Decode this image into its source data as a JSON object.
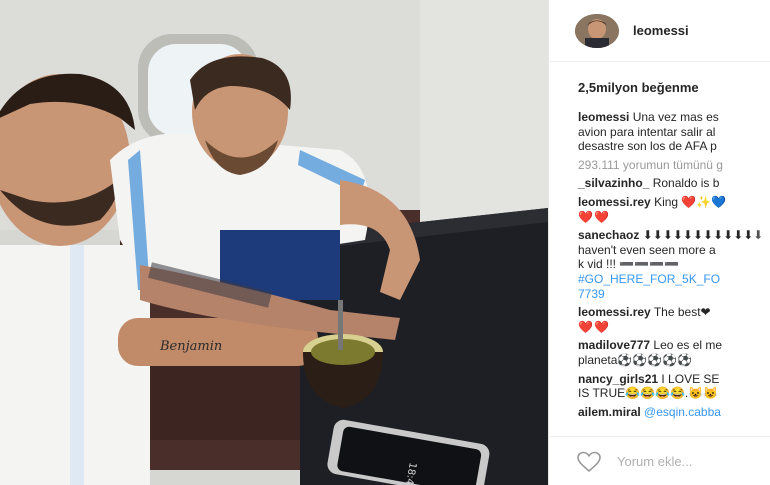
{
  "post": {
    "username": "leomessi",
    "likes": "2,5milyon beğenme",
    "caption": {
      "user": "leomessi",
      "lines": [
        "Una vez mas es",
        "avion para intentar salir al",
        "desastre son los de AFA p"
      ]
    },
    "view_all": "293.111 yorumun tümünü g",
    "comments": [
      {
        "user": "_silvazinho_",
        "lines": [
          "Ronaldo is b"
        ]
      },
      {
        "user": "leomessi.rey",
        "lines": [
          "King ❤️✨💙",
          "❤️❤️"
        ]
      },
      {
        "user": "sanechaoz",
        "lines": [
          "⬇⬇⬇⬇⬇⬇⬇⬇⬇⬇⬇⬇",
          "haven't even seen more a",
          "k vid !!! ➖➖➖➖"
        ],
        "tag_lines": [
          "#GO_HERE_FOR_5K_FO",
          "7739"
        ]
      },
      {
        "user": "leomessi.rey",
        "lines": [
          "The best❤",
          "❤️❤️"
        ]
      },
      {
        "user": "madilove777",
        "lines": [
          "Leo es el me",
          "planeta⚽⚽⚽⚽⚽"
        ]
      },
      {
        "user": "nancy_girls21",
        "lines": [
          "I LOVE SE",
          "IS TRUE😂😂😂😂.😺😺"
        ]
      },
      {
        "user": "ailem.miral",
        "tag": "@esqin.cabba"
      }
    ]
  },
  "comment_box": {
    "placeholder": "Yorum ekle..."
  },
  "photo": {
    "description_colors": {
      "shirt": "#f4f4f2",
      "stripe": "#74acdf",
      "skin": "#c99675",
      "hair": "#3b2a1f",
      "table": "#1e1f24",
      "seat": "#4a2e2a",
      "wall": "#d9d9d6",
      "window": "#eef3f6"
    }
  }
}
